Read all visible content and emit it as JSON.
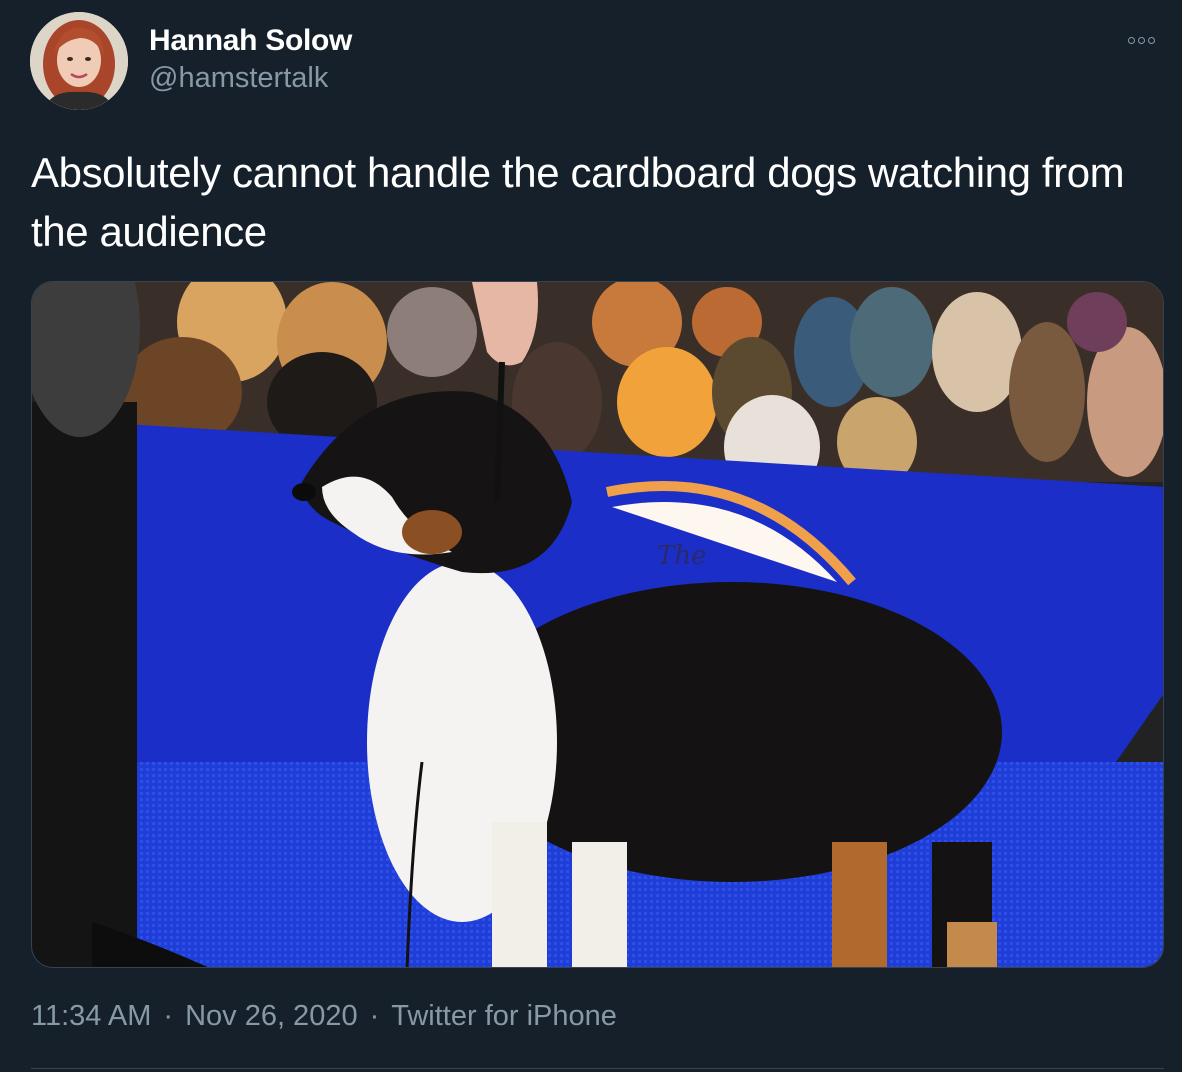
{
  "author": {
    "name": "Hannah Solow",
    "handle": "@hamstertalk"
  },
  "tweet": {
    "text": "Absolutely cannot handle the cardboard dogs watching from the audience",
    "time": "11:34 AM",
    "date": "Nov 26, 2020",
    "source": "Twitter for iPhone",
    "separator": "·"
  },
  "media": {
    "banner_text": "The"
  },
  "icons": {
    "more": "more-options-icon",
    "avatar": "avatar"
  },
  "colors": {
    "background": "#15202b",
    "text_primary": "#ffffff",
    "text_secondary": "#8899a6",
    "border": "#38444d"
  }
}
